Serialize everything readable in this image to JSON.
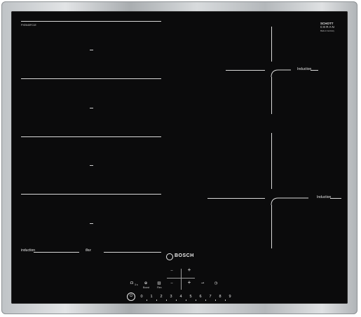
{
  "model": "PXE645FC1E",
  "brand": "BOSCH",
  "schott": {
    "line1": "SCHOTT",
    "line2": "CERAN",
    "line3": "Made in Germany"
  },
  "left_zone_label": "induction",
  "left_zone_mode": "flex",
  "right_top_label": "Induction",
  "right_bottom_label": "Induction",
  "controls": {
    "minus_top": "–",
    "plus_top": "+",
    "minus_bottom": "–",
    "plus_bottom": "+",
    "power": "⏻",
    "child_lock_label": "☊",
    "child_lock_text": "3 s",
    "boost_label": "⊕",
    "boost_text": "Boost",
    "flex_label": "▥",
    "flex_text": "Flex",
    "pan_icon": "⊸",
    "timer_icon": "◷"
  },
  "scale": [
    "0",
    "1",
    "2",
    "3",
    "4",
    "5",
    "6",
    "7",
    "8",
    "9"
  ],
  "colors": {
    "glass": "#0b0b0c",
    "lines": "#d9d9d9",
    "frame": "#c4c7ca"
  }
}
